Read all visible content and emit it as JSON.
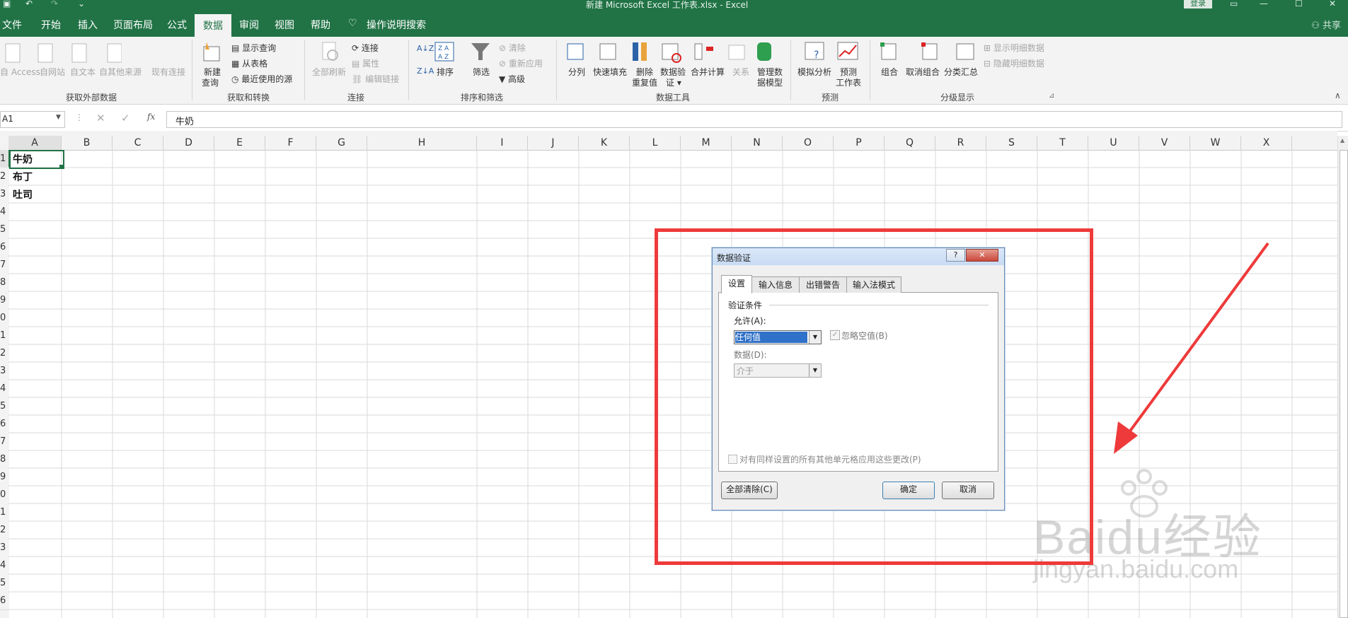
{
  "window": {
    "title": "新建 Microsoft Excel 工作表.xlsx  -  Excel",
    "login": "登录",
    "share": "共享"
  },
  "menu": {
    "items": [
      "文件",
      "开始",
      "插入",
      "页面布局",
      "公式",
      "数据",
      "审阅",
      "视图",
      "帮助"
    ],
    "active": "数据",
    "tell_me": "操作说明搜索"
  },
  "ribbon": {
    "external": {
      "access": "自 Access",
      "web": "自网站",
      "text": "自文本",
      "other": "自其他来源",
      "existing": "现有连接",
      "label": "获取外部数据"
    },
    "transform": {
      "new_query": "新建",
      "new_query2": "查询",
      "show_query": "显示查询",
      "from_table": "从表格",
      "recent": "最近使用的源",
      "label": "获取和转换"
    },
    "connections": {
      "refresh": "全部刷新",
      "connections": "连接",
      "properties": "属性",
      "edit_links": "编辑链接",
      "label": "连接"
    },
    "sort": {
      "sort": "排序",
      "filter": "筛选",
      "clear": "清除",
      "reapply": "重新应用",
      "advanced": "高级",
      "label": "排序和筛选"
    },
    "tools": {
      "split": "分列",
      "flash": "快速填充",
      "dup1": "删除",
      "dup2": "重复值",
      "val1": "数据验",
      "val2": "证",
      "consolidate": "合并计算",
      "relations": "关系",
      "model1": "管理数",
      "model2": "据模型",
      "label": "数据工具"
    },
    "forecast": {
      "whatif": "模拟分析",
      "sheet1": "预测",
      "sheet2": "工作表",
      "label": "预测"
    },
    "outline": {
      "group": "组合",
      "ungroup": "取消组合",
      "subtotal": "分类汇总",
      "show": "显示明细数据",
      "hide": "隐藏明细数据",
      "label": "分级显示"
    }
  },
  "formula_bar": {
    "name_box": "A1",
    "fx": "fx",
    "value": "牛奶"
  },
  "grid": {
    "columns": [
      "A",
      "B",
      "C",
      "D",
      "E",
      "F",
      "G",
      "H",
      "I",
      "J",
      "K",
      "L",
      "M",
      "N",
      "O",
      "P",
      "Q",
      "R",
      "S",
      "T",
      "U",
      "V",
      "W",
      "X"
    ],
    "rows": [
      "1",
      "2",
      "3",
      "4",
      "5",
      "6",
      "7",
      "8",
      "9",
      "0",
      "1",
      "2",
      "3",
      "4",
      "5",
      "6",
      "7",
      "8",
      "9",
      "0",
      "1",
      "2",
      "3",
      "4",
      "5",
      "6"
    ],
    "cells": {
      "a1": "牛奶",
      "a2": "布丁",
      "a3": "吐司"
    }
  },
  "dialog": {
    "title": "数据验证",
    "help": "?",
    "tabs": [
      "设置",
      "输入信息",
      "出错警告",
      "输入法模式"
    ],
    "section": "验证条件",
    "allow_label": "允许(A):",
    "allow_value": "任何值",
    "ignore_blank": "忽略空值(B)",
    "data_label": "数据(D):",
    "data_value": "介于",
    "apply_all": "对有同样设置的所有其他单元格应用这些更改(P)",
    "clear_all": "全部清除(C)",
    "ok": "确定",
    "cancel": "取消"
  },
  "watermark": {
    "brand": "Baidu经验",
    "url": "jingyan.baidu.com"
  },
  "colors": {
    "excel_green": "#217346",
    "highlight": "#ee3a3a"
  }
}
